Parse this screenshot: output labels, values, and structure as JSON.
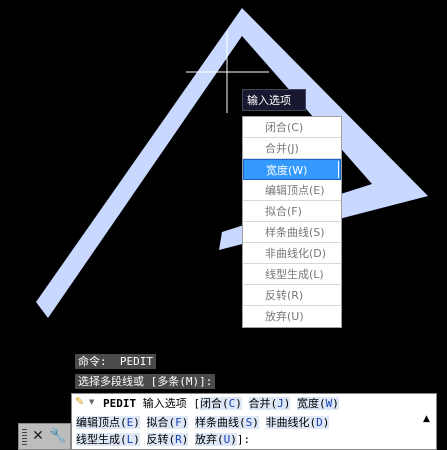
{
  "tooltip": "输入选项",
  "menu_items": [
    {
      "label": "闭合(C)",
      "selected": false
    },
    {
      "label": "合并(J)",
      "selected": false
    },
    {
      "label": "宽度(W)",
      "selected": true
    },
    {
      "label": "编辑顶点(E)",
      "selected": false
    },
    {
      "label": "拟合(F)",
      "selected": false
    },
    {
      "label": "样条曲线(S)",
      "selected": false
    },
    {
      "label": "非曲线化(D)",
      "selected": false
    },
    {
      "label": "线型生成(L)",
      "selected": false
    },
    {
      "label": "反转(R)",
      "selected": false
    },
    {
      "label": "放弃(U)",
      "selected": false
    }
  ],
  "history": {
    "line1": "命令:  PEDIT",
    "line2": "选择多段线或 [多条(M)]:"
  },
  "prompt": {
    "command": "PEDIT",
    "text": "输入选项 [",
    "line1_options": [
      {
        "pre": "闭合(",
        "key": "C",
        "post": ")"
      },
      {
        "pre": "合并(",
        "key": "J",
        "post": ")"
      },
      {
        "pre": "宽度(",
        "key": "W",
        "post": ")"
      }
    ],
    "line2_options": [
      {
        "pre": "编辑顶点(",
        "key": "E",
        "post": ")"
      },
      {
        "pre": "拟合(",
        "key": "F",
        "post": ")"
      },
      {
        "pre": "样条曲线(",
        "key": "S",
        "post": ")"
      },
      {
        "pre": "非曲线化(",
        "key": "D",
        "post": ")"
      }
    ],
    "line3_options": [
      {
        "pre": "线型生成(",
        "key": "L",
        "post": ")"
      },
      {
        "pre": "反转(",
        "key": "R",
        "post": ")"
      },
      {
        "pre": "放弃(",
        "key": "U",
        "post": ")"
      }
    ],
    "end": "]:"
  },
  "icons": {
    "close": "close-icon",
    "customize": "wrench-icon",
    "pencil": "pencil-icon",
    "scroll_up": "scroll-up-icon",
    "grip": "grip-icon"
  },
  "colors": {
    "background": "#000000",
    "polyline": "#c8d8ff",
    "selected": "#3399ff",
    "option_key": "#1a3fbf"
  }
}
